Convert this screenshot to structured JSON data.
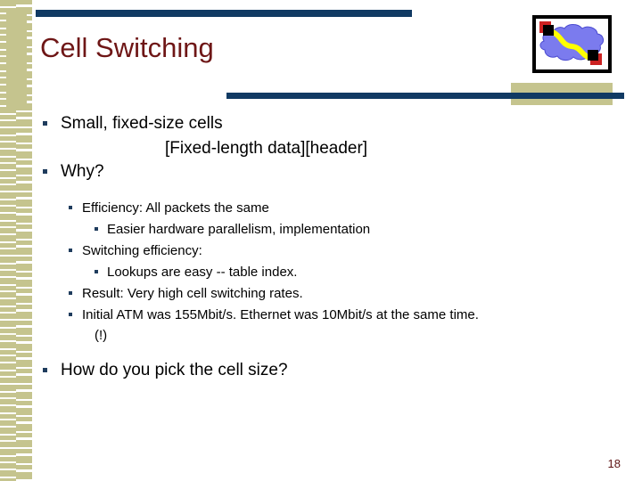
{
  "slide": {
    "title": "Cell Switching",
    "page_number": "18",
    "colors": {
      "title": "#6e1616",
      "rule_navy": "#113a63",
      "deco_tan": "#c5c48e",
      "bullet_navy": "#1f3c5d",
      "page_number": "#5e1414",
      "cloud_blue": "#7b7bee",
      "cable_yellow": "#ffff00",
      "node_red": "#cc2222",
      "node_black": "#000000"
    },
    "clipart": {
      "name": "network-cloud-clipart",
      "description": "Network cloud with yellow link connecting two nodes"
    },
    "content": [
      {
        "level": 1,
        "text": "Small, fixed-size cells"
      },
      {
        "level": "sub-line",
        "text": "[Fixed-length data][header]"
      },
      {
        "level": 1,
        "text": "Why?"
      },
      {
        "level": 2,
        "text": "Efficiency:  All packets the same"
      },
      {
        "level": 3,
        "text": "Easier hardware parallelism, implementation"
      },
      {
        "level": 2,
        "text": "Switching efficiency:"
      },
      {
        "level": 3,
        "text": "Lookups are easy -- table index."
      },
      {
        "level": 2,
        "text": "Result:  Very high cell switching rates."
      },
      {
        "level": 2,
        "text": "Initial ATM was 155Mbit/s.  Ethernet was 10Mbit/s at the same time."
      },
      {
        "level": "continuation",
        "text": "(!)"
      },
      {
        "level": 1,
        "text": "How do you pick the cell size?"
      }
    ]
  }
}
